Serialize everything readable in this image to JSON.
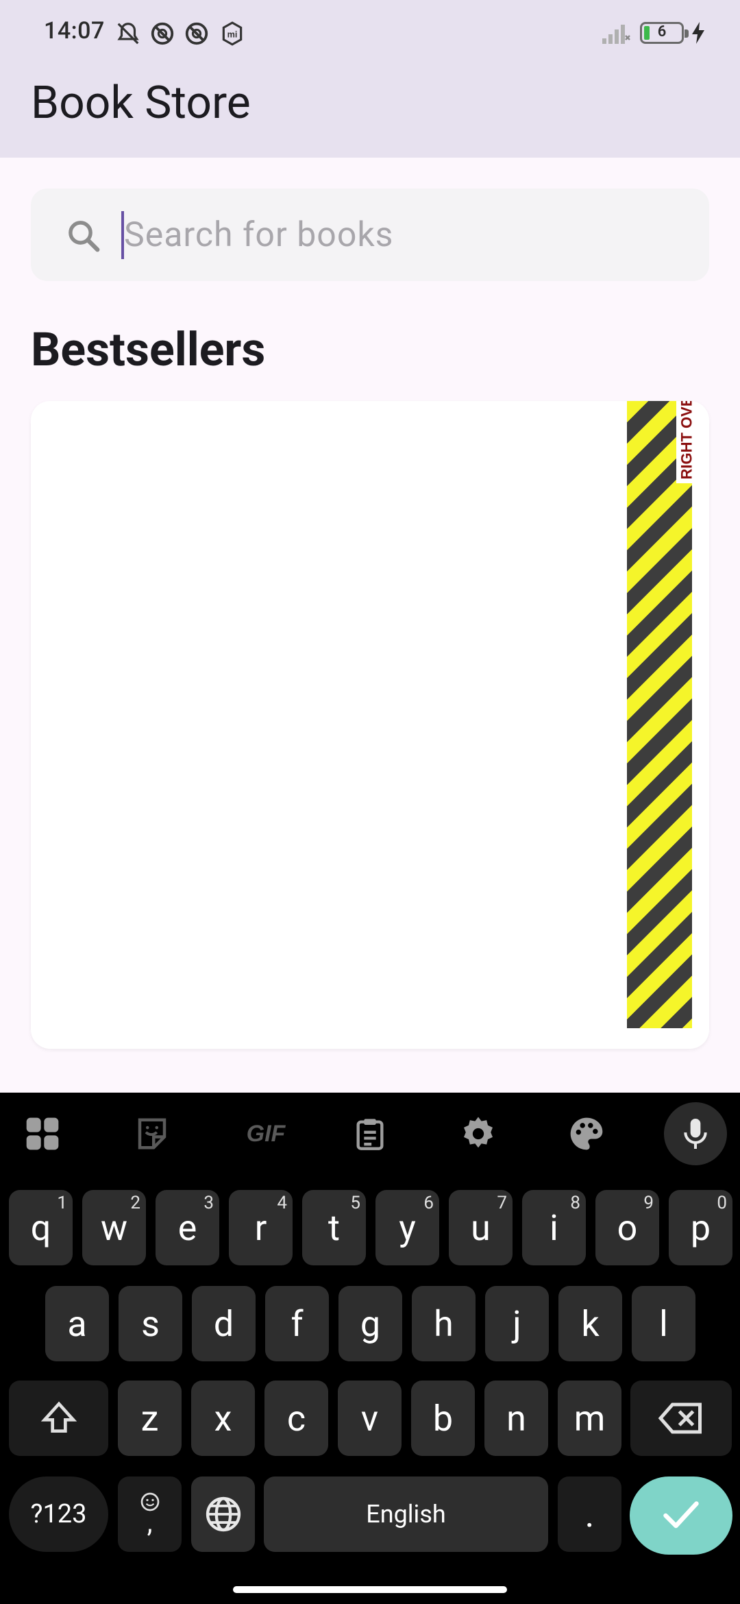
{
  "status": {
    "time": "14:07",
    "battery_level": "6",
    "icons": [
      "notifications-off-icon",
      "do-not-disturb-icon",
      "do-not-disturb-icon",
      "mi-icon",
      "signal-icon",
      "battery-icon",
      "charging-bolt-icon"
    ]
  },
  "app_bar": {
    "title": "Book Store"
  },
  "search": {
    "placeholder": "Search for books",
    "value": ""
  },
  "bestsellers": {
    "title": "Bestsellers",
    "book_cover_text": "RIGHT OVER"
  },
  "keyboard": {
    "toolbar": [
      "apps-grid-icon",
      "sticker-icon",
      "gif-icon",
      "clipboard-icon",
      "settings-gear-icon",
      "palette-icon",
      "mic-icon"
    ],
    "gif_label": "GIF",
    "row1": [
      {
        "k": "q",
        "s": "1"
      },
      {
        "k": "w",
        "s": "2"
      },
      {
        "k": "e",
        "s": "3"
      },
      {
        "k": "r",
        "s": "4"
      },
      {
        "k": "t",
        "s": "5"
      },
      {
        "k": "y",
        "s": "6"
      },
      {
        "k": "u",
        "s": "7"
      },
      {
        "k": "i",
        "s": "8"
      },
      {
        "k": "o",
        "s": "9"
      },
      {
        "k": "p",
        "s": "0"
      }
    ],
    "row2": [
      "a",
      "s",
      "d",
      "f",
      "g",
      "h",
      "j",
      "k",
      "l"
    ],
    "row3": [
      "z",
      "x",
      "c",
      "v",
      "b",
      "n",
      "m"
    ],
    "symbols_label": "?123",
    "emoji_comma": ",",
    "space_label": "English",
    "period": ".",
    "accent_color": "#7fd4c8"
  }
}
